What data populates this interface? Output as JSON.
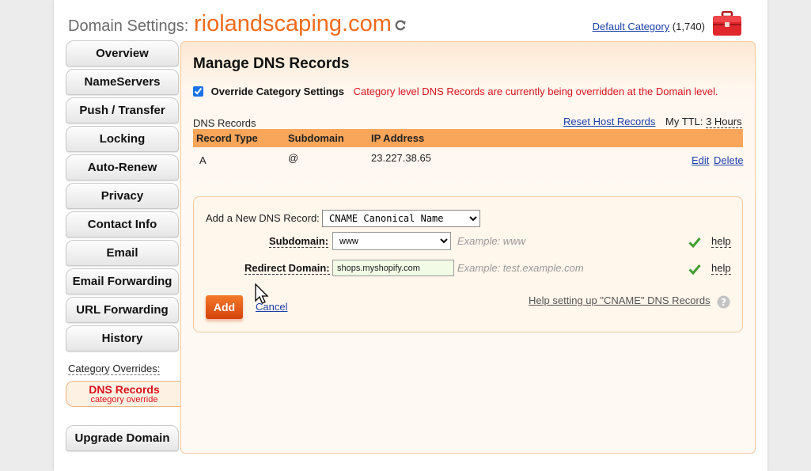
{
  "header": {
    "label": "Domain Settings:",
    "domain": "riolandscaping.com",
    "refresh_icon": "refresh-icon",
    "default_category_link": "Default Category",
    "default_category_count": "(1,740)",
    "toolbox_icon": "toolbox-icon",
    "toolbox_color": "#e0272b"
  },
  "sidebar": {
    "items": [
      {
        "label": "Overview"
      },
      {
        "label": "NameServers"
      },
      {
        "label": "Push / Transfer"
      },
      {
        "label": "Locking"
      },
      {
        "label": "Auto-Renew"
      },
      {
        "label": "Privacy"
      },
      {
        "label": "Contact Info"
      },
      {
        "label": "Email"
      },
      {
        "label": "Email Forwarding"
      },
      {
        "label": "URL Forwarding"
      },
      {
        "label": "History"
      }
    ],
    "category_overrides_label": "Category Overrides:",
    "active_item": {
      "label": "DNS Records",
      "sub": "category override"
    },
    "upgrade_label": "Upgrade Domain"
  },
  "main": {
    "title": "Manage DNS Records",
    "override": {
      "checked": true,
      "label": "Override Category Settings",
      "message": "Category level DNS Records are currently being overridden at the Domain level."
    },
    "dns_records_label": "DNS Records",
    "reset_link": "Reset Host Records",
    "ttl_label": "My TTL:",
    "ttl_value": "3 Hours",
    "table": {
      "headers": [
        "Record Type",
        "Subdomain",
        "IP Address"
      ],
      "rows": [
        {
          "type": "A",
          "subdomain": "@",
          "ip": "23.227.38.65",
          "edit": "Edit",
          "delete": "Delete"
        }
      ]
    },
    "add_record": {
      "label": "Add a New DNS Record:",
      "type_selected": "CNAME Canonical Name",
      "subdomain_label": "Subdomain:",
      "subdomain_value": "www",
      "subdomain_example": "Example: www",
      "redirect_label": "Redirect Domain:",
      "redirect_value": "shops.myshopify.com",
      "redirect_example": "Example: test.example.com",
      "help": "help",
      "add_button": "Add",
      "cancel": "Cancel",
      "help_cname": "Help setting up \"CNAME\" DNS Records",
      "check_icon": "check-icon",
      "question_icon": "question-icon"
    }
  },
  "colors": {
    "accent": "#f26a1b",
    "table_header": "#f9a55a",
    "warning_text": "#d9121b",
    "link": "#1c3fa8"
  }
}
